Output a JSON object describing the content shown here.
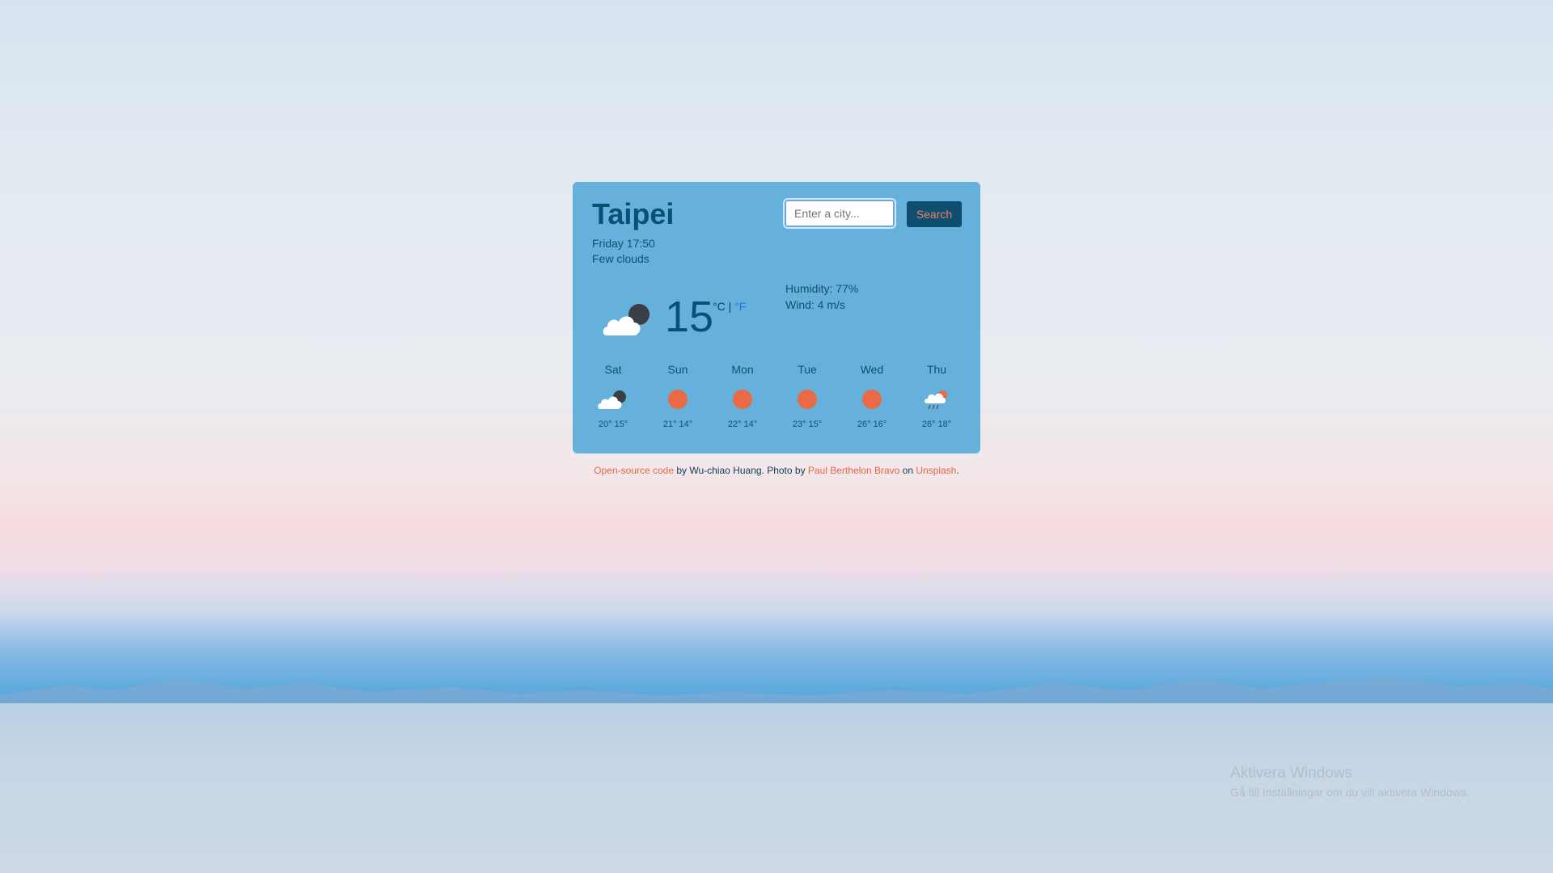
{
  "weather": {
    "city": "Taipei",
    "datetime": "Friday 17:50",
    "description": "Few clouds",
    "temperature": "15",
    "unit_c": "°C",
    "unit_sep": " | ",
    "unit_f": "°F",
    "humidity": "Humidity: 77%",
    "wind": "Wind: 4 m/s",
    "current_icon": "cloud-moon-icon"
  },
  "search": {
    "placeholder": "Enter a city...",
    "button_label": "Search"
  },
  "forecast": [
    {
      "day": "Sat",
      "temps": "20° 15°",
      "icon": "cloud-moon-icon"
    },
    {
      "day": "Sun",
      "temps": "21° 14°",
      "icon": "sun-icon"
    },
    {
      "day": "Mon",
      "temps": "22° 14°",
      "icon": "sun-icon"
    },
    {
      "day": "Tue",
      "temps": "23° 15°",
      "icon": "sun-icon"
    },
    {
      "day": "Wed",
      "temps": "26° 16°",
      "icon": "sun-icon"
    },
    {
      "day": "Thu",
      "temps": "26° 18°",
      "icon": "rain-cloud-sun-icon"
    }
  ],
  "credits": {
    "code_link": "Open-source code",
    "by_text": " by Wu-chiao Huang. Photo by ",
    "photographer_link": "Paul Berthelon Bravo",
    "on_text": " on ",
    "source_link": "Unsplash",
    "end_text": "."
  },
  "windows_notice": {
    "title": "Aktivera Windows",
    "subtitle": "Gå till Inställningar om du vill aktivera Windows."
  },
  "colors": {
    "card": "#65b1db",
    "accent": "#ea6a48",
    "dark_blue": "#0a4f74"
  }
}
